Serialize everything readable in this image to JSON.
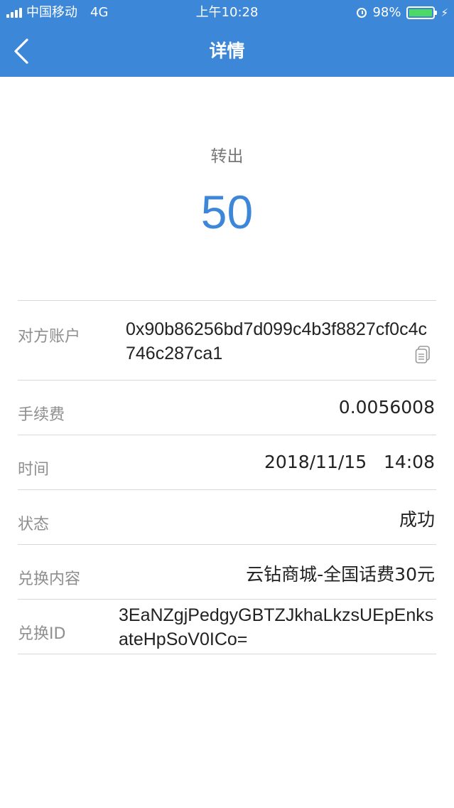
{
  "status_bar": {
    "carrier": "中国移动",
    "network": "4G",
    "time": "上午10:28",
    "battery": "98%",
    "battery_level": 0.98,
    "signal_bars": 4
  },
  "nav": {
    "title": "详情"
  },
  "summary": {
    "type_label": "转出",
    "amount": "50"
  },
  "details": {
    "counterparty": {
      "label": "对方账户",
      "value": "0x90b86256bd7d099c4b3f8827cf0c4c746c287ca1"
    },
    "fee": {
      "label": "手续费",
      "value": "0.0056008"
    },
    "time": {
      "label": "时间",
      "value": "2018/11/15   14:08"
    },
    "status": {
      "label": "状态",
      "value": "成功"
    },
    "exchange_content": {
      "label": "兑换内容",
      "value": "云钻商城-全国话费30元"
    },
    "exchange_id": {
      "label": "兑换ID",
      "value": "3EaNZgjPedgyGBTZJkhaLkzsUEpEnksateHpSoV0ICo="
    }
  },
  "colors": {
    "header_bg": "#3d87d9",
    "amount": "#3d87d9",
    "battery_fill": "#4cd964"
  }
}
